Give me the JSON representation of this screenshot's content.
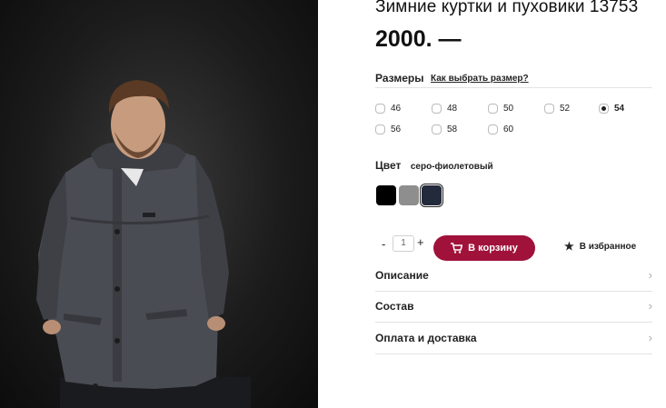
{
  "product": {
    "title": "Зимние куртки и пуховики 13753",
    "price": "2000. —",
    "image_alt": "man-in-grey-winter-parka"
  },
  "sizes": {
    "label": "Размеры",
    "help_link": "Как выбрать размер?",
    "options": [
      "46",
      "48",
      "50",
      "52",
      "54",
      "56",
      "58",
      "60"
    ],
    "selected": "54"
  },
  "color": {
    "label": "Цвет",
    "selected_name": "серо-фиолетовый",
    "swatches": [
      "#000000",
      "#8e8e8e",
      "#232a3c"
    ]
  },
  "quantity": {
    "minus": "-",
    "value": "1",
    "plus": "+"
  },
  "actions": {
    "add_to_cart": "В корзину",
    "cart_icon": "cart-icon",
    "favorite": "В избранное",
    "favorite_icon": "star-icon"
  },
  "accordion": [
    {
      "label": "Описание"
    },
    {
      "label": "Состав"
    },
    {
      "label": "Оплата и доставка"
    }
  ],
  "colors": {
    "accent": "#a0123a",
    "divider": "#e3e3e3"
  }
}
